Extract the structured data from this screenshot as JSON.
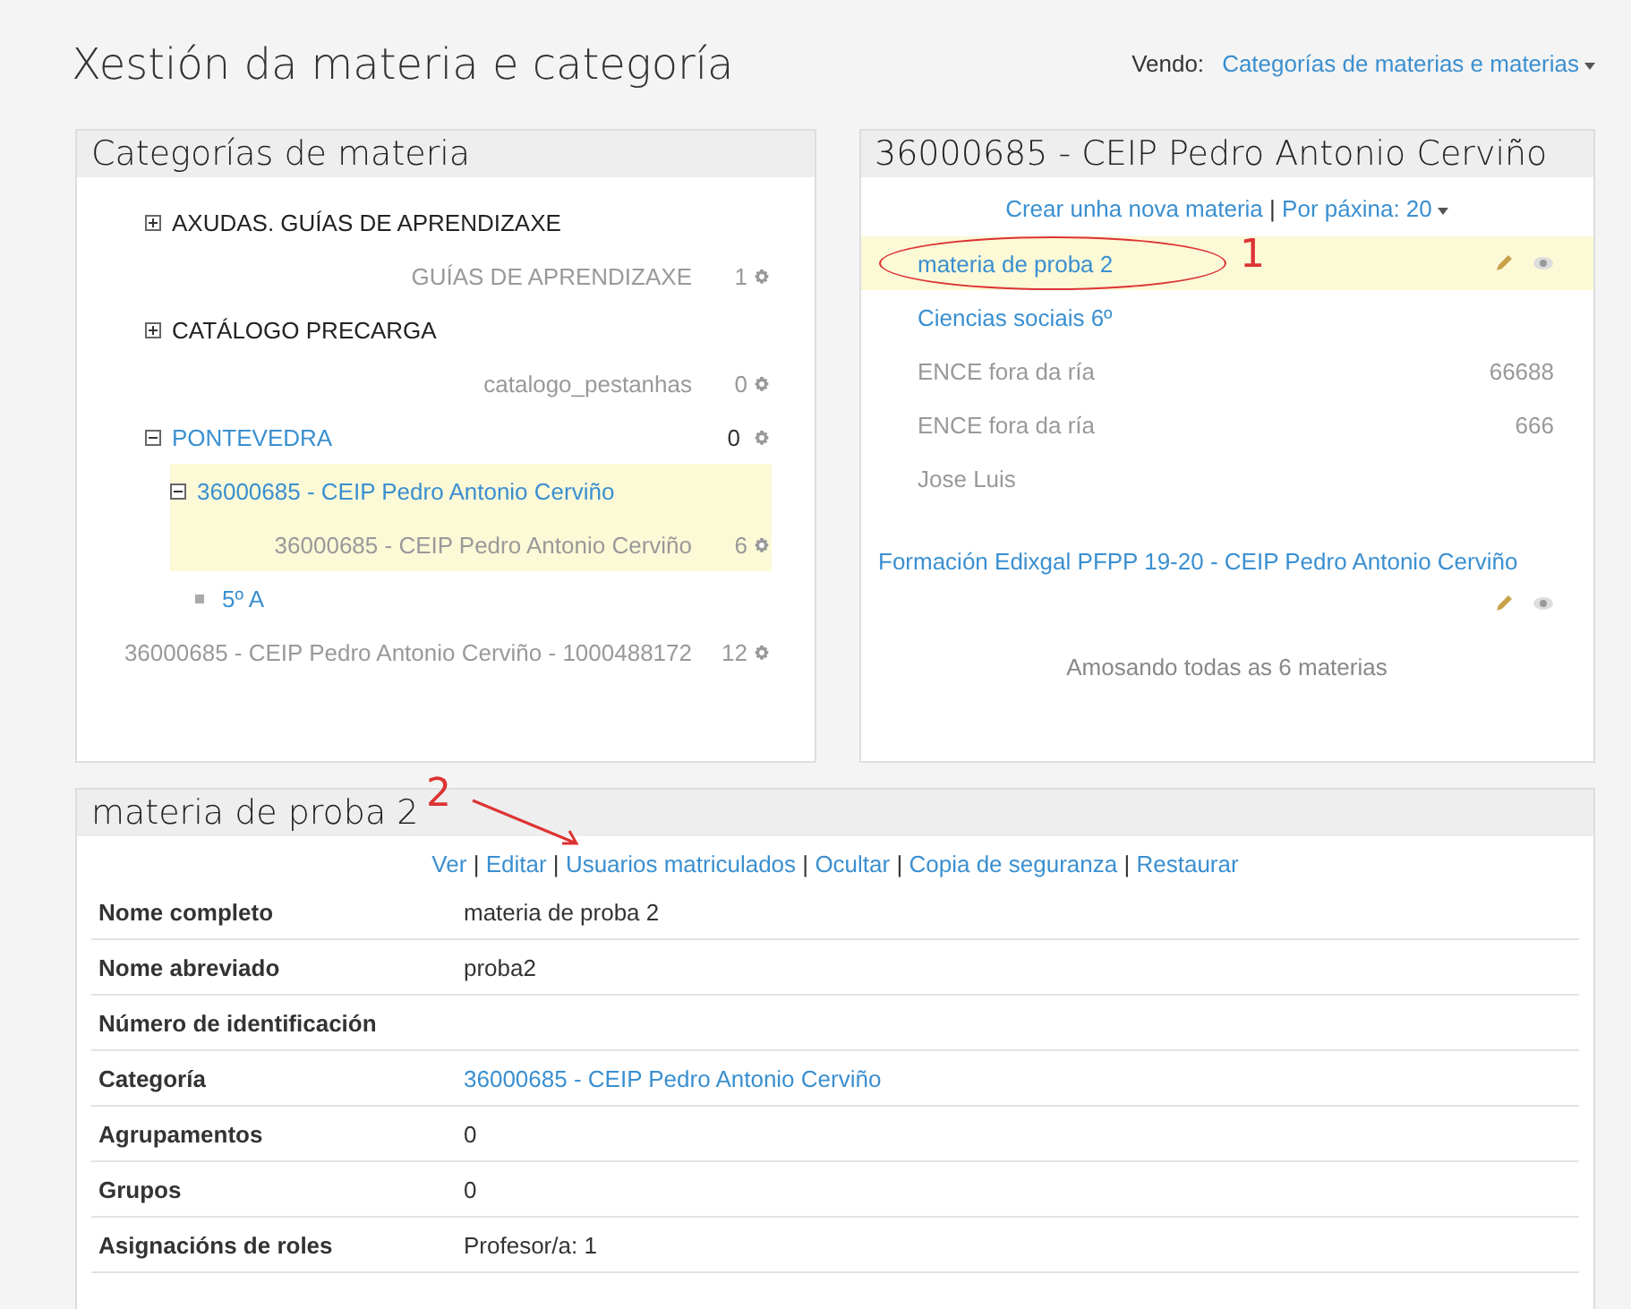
{
  "page_title": "Xestión da materia e categoría",
  "viewing": {
    "label": "Vendo:",
    "value": "Categorías de materias e materias"
  },
  "categories_panel": {
    "title": "Categorías de materia",
    "tree": [
      {
        "kind": "expandable",
        "name": "AXUDAS. GUÍAS DE APRENDIZAXE",
        "expanded": false,
        "selected": false,
        "courses": [
          {
            "name": "GUÍAS DE APRENDIZAXE",
            "count": "1"
          }
        ]
      },
      {
        "kind": "expandable",
        "name": "CATÁLOGO PRECARGA",
        "expanded": false,
        "selected": false,
        "courses": [
          {
            "name": "catalogo_pestanhas",
            "count": "0"
          }
        ]
      },
      {
        "kind": "expandable",
        "name": "PONTEVEDRA",
        "expanded": true,
        "selected": false,
        "count": "0",
        "children": [
          {
            "kind": "expandable",
            "name": "36000685 - CEIP Pedro Antonio Cerviño",
            "expanded": true,
            "selected": true,
            "courses": [
              {
                "name": "36000685 - CEIP Pedro Antonio Cerviño",
                "count": "6"
              }
            ],
            "children": [
              {
                "kind": "leaf",
                "name": "5º A"
              }
            ]
          }
        ],
        "courses": [
          {
            "name": "36000685 - CEIP Pedro Antonio Cerviño - 1000488172",
            "count": "12"
          }
        ]
      }
    ]
  },
  "courses_panel": {
    "title": "36000685 - CEIP Pedro Antonio Cerviño",
    "create_link": "Crear unha nova materia",
    "separator": "|",
    "per_page": "Por páxina: 20",
    "courses": [
      {
        "name": "materia de proba 2",
        "visible": true,
        "selected": true,
        "actions": true,
        "annotation": "1"
      },
      {
        "name": "Ciencias sociais 6º",
        "visible": true,
        "selected": false,
        "actions": false
      },
      {
        "name": "ENCE fora da ría",
        "visible": false,
        "selected": false,
        "actions": false,
        "id": "66688"
      },
      {
        "name": "ENCE fora da ría",
        "visible": false,
        "selected": false,
        "actions": false,
        "id": "666"
      },
      {
        "name": "Jose Luis",
        "visible": false,
        "selected": false,
        "actions": false
      },
      {
        "name": "Formación Edixgal PFPP 19-20 - CEIP Pedro Antonio Cerviño",
        "visible": true,
        "selected": false,
        "actions": true,
        "wide": true
      }
    ],
    "footer": "Amosando todas as 6 materias"
  },
  "detail_panel": {
    "title": "materia de proba 2",
    "separator": "|",
    "links": [
      {
        "label": "Ver"
      },
      {
        "label": "Editar"
      },
      {
        "label": "Usuarios matriculados",
        "annotation": "2"
      },
      {
        "label": "Ocultar"
      },
      {
        "label": "Copia de seguranza"
      },
      {
        "label": "Restaurar"
      }
    ],
    "rows": [
      {
        "label": "Nome completo",
        "value": "materia de proba 2",
        "link": false
      },
      {
        "label": "Nome abreviado",
        "value": "proba2",
        "link": false
      },
      {
        "label": "Número de identificación"
      },
      {
        "label": "Categoría",
        "value": "36000685 - CEIP Pedro Antonio Cerviño",
        "link": true
      },
      {
        "label": "Agrupamentos",
        "value": "0",
        "link": false
      },
      {
        "label": "Grupos",
        "value": "0",
        "link": false
      },
      {
        "label": "Asignacións de roles",
        "value": "Profesor/a: 1",
        "link": false
      }
    ]
  }
}
